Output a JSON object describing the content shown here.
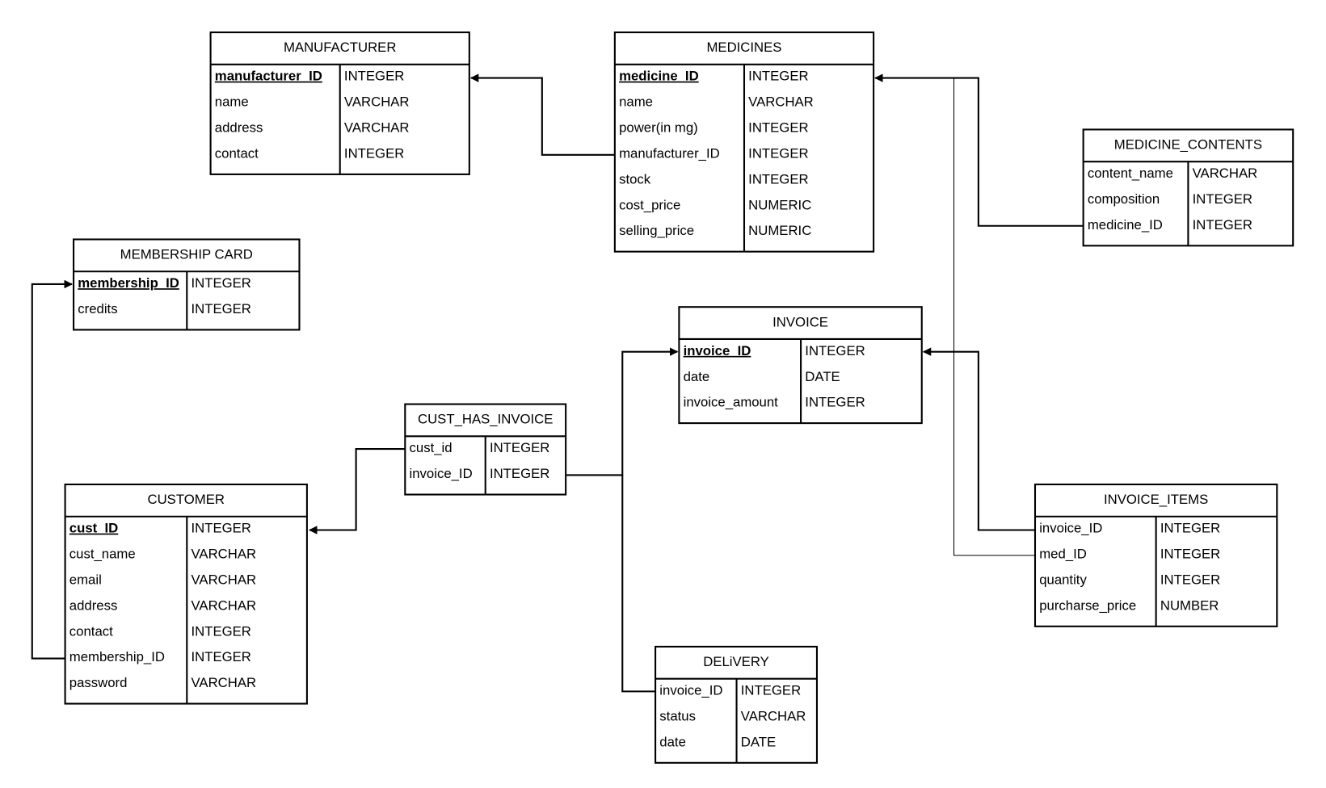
{
  "diagram": {
    "type": "entity-relationship",
    "colors": {
      "line": "#000000",
      "background": "#ffffff"
    },
    "tables": [
      {
        "id": "manufacturer",
        "title": "MANUFACTURER",
        "fields": [
          {
            "name": "manufacturer_ID",
            "type": "INTEGER",
            "primary_key": true
          },
          {
            "name": "name",
            "type": "VARCHAR"
          },
          {
            "name": "address",
            "type": "VARCHAR"
          },
          {
            "name": "contact",
            "type": "INTEGER"
          }
        ]
      },
      {
        "id": "medicines",
        "title": "MEDICINES",
        "fields": [
          {
            "name": "medicine_ID",
            "type": "INTEGER",
            "primary_key": true
          },
          {
            "name": "name",
            "type": "VARCHAR"
          },
          {
            "name": "power(in mg)",
            "type": "INTEGER"
          },
          {
            "name": "manufacturer_ID",
            "type": "INTEGER"
          },
          {
            "name": "stock",
            "type": "INTEGER"
          },
          {
            "name": "cost_price",
            "type": "NUMERIC"
          },
          {
            "name": "selling_price",
            "type": "NUMERIC"
          }
        ]
      },
      {
        "id": "medicine_contents",
        "title": "MEDICINE_CONTENTS",
        "fields": [
          {
            "name": "content_name",
            "type": "VARCHAR"
          },
          {
            "name": "composition",
            "type": "INTEGER"
          },
          {
            "name": "medicine_ID",
            "type": "INTEGER"
          }
        ]
      },
      {
        "id": "membership_card",
        "title": "MEMBERSHIP CARD",
        "fields": [
          {
            "name": "membership_ID",
            "type": "INTEGER",
            "primary_key": true
          },
          {
            "name": "credits",
            "type": "INTEGER"
          }
        ]
      },
      {
        "id": "invoice",
        "title": "INVOICE",
        "fields": [
          {
            "name": "invoice_ID",
            "type": "INTEGER",
            "primary_key": true
          },
          {
            "name": "date",
            "type": "DATE"
          },
          {
            "name": "invoice_amount",
            "type": "INTEGER"
          }
        ]
      },
      {
        "id": "cust_has_invoice",
        "title": "CUST_HAS_INVOICE",
        "fields": [
          {
            "name": "cust_id",
            "type": "INTEGER"
          },
          {
            "name": "invoice_ID",
            "type": "INTEGER"
          }
        ]
      },
      {
        "id": "customer",
        "title": "CUSTOMER",
        "fields": [
          {
            "name": "cust_ID",
            "type": "INTEGER",
            "primary_key": true
          },
          {
            "name": "cust_name",
            "type": "VARCHAR"
          },
          {
            "name": "email",
            "type": "VARCHAR"
          },
          {
            "name": "address",
            "type": "VARCHAR"
          },
          {
            "name": "contact",
            "type": "INTEGER"
          },
          {
            "name": "membership_ID",
            "type": "INTEGER"
          },
          {
            "name": "password",
            "type": "VARCHAR"
          }
        ]
      },
      {
        "id": "invoice_items",
        "title": "INVOICE_ITEMS",
        "fields": [
          {
            "name": "invoice_ID",
            "type": "INTEGER"
          },
          {
            "name": "med_ID",
            "type": "INTEGER"
          },
          {
            "name": "quantity",
            "type": "INTEGER"
          },
          {
            "name": "purcharse_price",
            "type": "NUMBER"
          }
        ]
      },
      {
        "id": "delivery",
        "title": "DELiVERY",
        "fields": [
          {
            "name": "invoice_ID",
            "type": "INTEGER"
          },
          {
            "name": "status",
            "type": "VARCHAR"
          },
          {
            "name": "date",
            "type": "DATE"
          }
        ]
      }
    ],
    "relationships": [
      {
        "from": "medicines.manufacturer_ID",
        "to": "manufacturer.manufacturer_ID"
      },
      {
        "from": "medicine_contents.medicine_ID",
        "to": "medicines.medicine_ID"
      },
      {
        "from": "invoice_items.med_ID",
        "to": "medicines.medicine_ID"
      },
      {
        "from": "invoice_items.invoice_ID",
        "to": "invoice.invoice_ID"
      },
      {
        "from": "cust_has_invoice.invoice_ID",
        "to": "invoice.invoice_ID"
      },
      {
        "from": "delivery.invoice_ID",
        "to": "invoice.invoice_ID"
      },
      {
        "from": "cust_has_invoice.cust_id",
        "to": "customer.cust_ID"
      },
      {
        "from": "customer.membership_ID",
        "to": "membership_card.membership_ID"
      }
    ]
  }
}
